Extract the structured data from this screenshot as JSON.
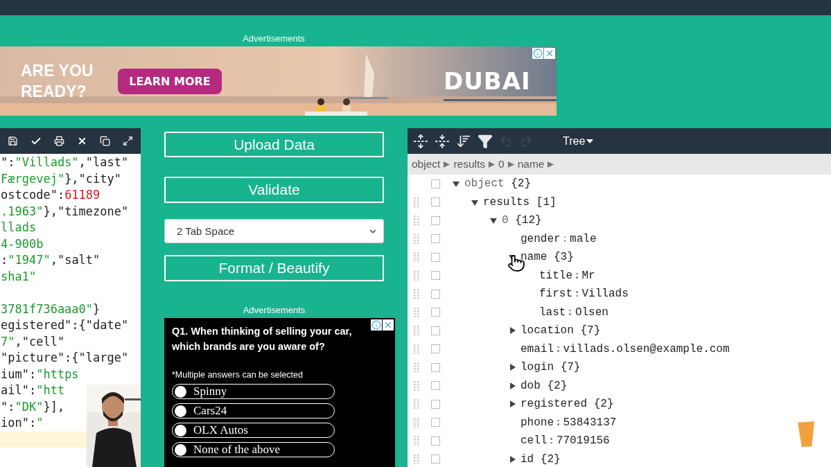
{
  "top_ad": {
    "label": "Advertisements",
    "headline": "ARE YOU READY?",
    "cta": "LEARN MORE",
    "logo": "DUBAI"
  },
  "editor": {
    "lines": [
      {
        "highlighted": false,
        "tokens": [
          {
            "text": "\":",
            "kind": "plain"
          },
          {
            "text": "\"Villads\"",
            "kind": "string"
          },
          {
            "text": ",\"last\"",
            "kind": "plain"
          }
        ]
      },
      {
        "highlighted": false,
        "tokens": [
          {
            "text": "Færgevej\"",
            "kind": "string"
          },
          {
            "text": "},\"city\"",
            "kind": "plain"
          }
        ]
      },
      {
        "highlighted": false,
        "tokens": [
          {
            "text": "ostcode\":",
            "kind": "plain"
          },
          {
            "text": "61189",
            "kind": "number"
          }
        ]
      },
      {
        "highlighted": false,
        "tokens": [
          {
            "text": ".1963\"",
            "kind": "string"
          },
          {
            "text": "},\"timezone\"",
            "kind": "plain"
          }
        ]
      },
      {
        "highlighted": false,
        "tokens": [
          {
            "text": "llads",
            "kind": "string"
          }
        ]
      },
      {
        "highlighted": false,
        "tokens": [
          {
            "text": "4-900b",
            "kind": "string"
          }
        ]
      },
      {
        "highlighted": false,
        "tokens": [
          {
            "text": ":",
            "kind": "plain"
          },
          {
            "text": "\"1947\"",
            "kind": "string"
          },
          {
            "text": ",\"salt\"",
            "kind": "plain"
          }
        ]
      },
      {
        "highlighted": false,
        "tokens": [
          {
            "text": "sha1\"",
            "kind": "string"
          }
        ]
      },
      {
        "highlighted": false
      },
      {
        "highlighted": false,
        "tokens": [
          {
            "text": "3781f736aaa0\"",
            "kind": "string"
          },
          {
            "text": "}",
            "kind": "plain"
          }
        ]
      },
      {
        "highlighted": false,
        "tokens": [
          {
            "text": "egistered\":{\"date\"",
            "kind": "plain"
          }
        ]
      },
      {
        "highlighted": false,
        "tokens": [
          {
            "text": "7\"",
            "kind": "string"
          },
          {
            "text": ",\"cell\"",
            "kind": "plain"
          }
        ]
      },
      {
        "highlighted": false,
        "tokens": [
          {
            "text": "\"picture\":{\"large\"",
            "kind": "plain"
          }
        ]
      },
      {
        "highlighted": false,
        "tokens": [
          {
            "text": "ium\":",
            "kind": "plain"
          },
          {
            "text": "\"https",
            "kind": "string"
          }
        ]
      },
      {
        "highlighted": false,
        "tokens": [
          {
            "text": "ail\":",
            "kind": "plain"
          },
          {
            "text": "\"htt",
            "kind": "string"
          }
        ]
      },
      {
        "highlighted": false,
        "tokens": [
          {
            "text": "\":",
            "kind": "plain"
          },
          {
            "text": "\"DK\"",
            "kind": "string"
          },
          {
            "text": "}],",
            "kind": "plain"
          }
        ]
      },
      {
        "highlighted": false,
        "tokens": [
          {
            "text": "ion\":",
            "kind": "plain"
          },
          {
            "text": "\"",
            "kind": "string"
          }
        ]
      },
      {
        "highlighted": true
      }
    ]
  },
  "actions": {
    "upload": "Upload Data",
    "validate": "Validate",
    "indent_select": {
      "value": "2 Tab Space"
    },
    "format": "Format / Beautify"
  },
  "side_ad": {
    "label": "Advertisements",
    "question": "Q1. When thinking of selling your car, which brands are you aware of?",
    "note": "*Multiple answers can be selected",
    "options": [
      {
        "label": "Spinny",
        "selected": false
      },
      {
        "label": "Cars24",
        "selected": false
      },
      {
        "label": "OLX Autos",
        "selected": false
      },
      {
        "label": "None of the above",
        "selected": false
      }
    ]
  },
  "viewer": {
    "mode": "Tree",
    "undo_enabled": false,
    "redo_enabled": false,
    "breadcrumb": [
      "object",
      "results",
      "0",
      "name"
    ],
    "tree": [
      {
        "key": "object",
        "count": "{2}",
        "expanded": true,
        "checked": false,
        "children": [
          {
            "key": "results",
            "count": "[1]",
            "expanded": true,
            "checked": false,
            "children": [
              {
                "key": "0",
                "count": "{12}",
                "expanded": true,
                "checked": false,
                "children": [
                  {
                    "key": "gender",
                    "value": "male",
                    "checked": false
                  },
                  {
                    "key": "name",
                    "count": "{3}",
                    "expanded": true,
                    "checked": false,
                    "children": [
                      {
                        "key": "title",
                        "value": "Mr",
                        "checked": false
                      },
                      {
                        "key": "first",
                        "value": "Villads",
                        "checked": false
                      },
                      {
                        "key": "last",
                        "value": "Olsen",
                        "checked": false
                      }
                    ]
                  },
                  {
                    "key": "location",
                    "count": "{7}",
                    "expanded": false,
                    "checked": false
                  },
                  {
                    "key": "email",
                    "value": "villads.olsen@example.com",
                    "checked": false
                  },
                  {
                    "key": "login",
                    "count": "{7}",
                    "expanded": false,
                    "checked": false
                  },
                  {
                    "key": "dob",
                    "count": "{2}",
                    "expanded": false,
                    "checked": false
                  },
                  {
                    "key": "registered",
                    "count": "{2}",
                    "expanded": false,
                    "checked": false
                  },
                  {
                    "key": "phone",
                    "value": "53843137",
                    "checked": false
                  },
                  {
                    "key": "cell",
                    "value": "77019156",
                    "checked": false
                  },
                  {
                    "key": "id",
                    "count": "{2}",
                    "expanded": false,
                    "checked": false
                  }
                ]
              }
            ]
          }
        ]
      }
    ]
  }
}
